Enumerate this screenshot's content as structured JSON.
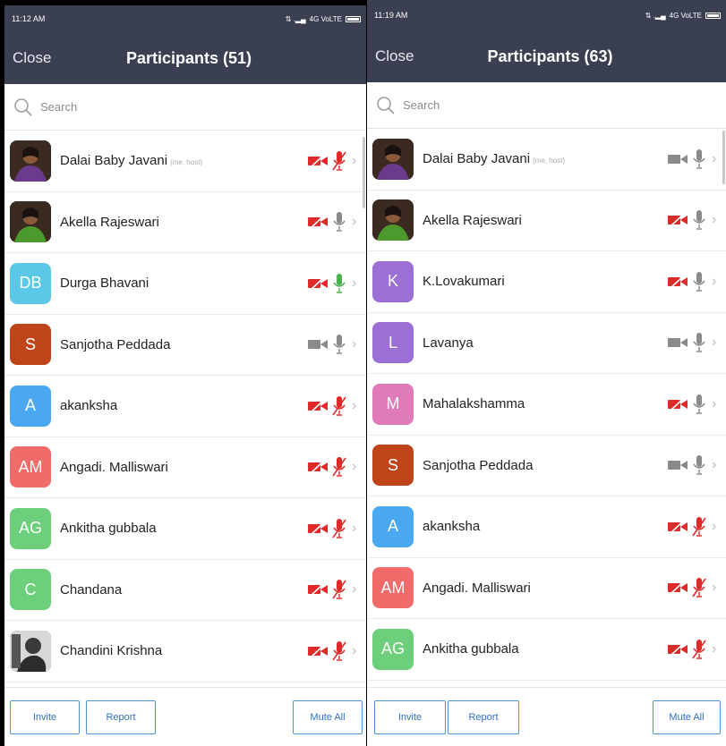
{
  "colors": {
    "header_bg": "#3b3f52",
    "muted_red": "#e02a2a",
    "unmuted_gray": "#8a8a8a",
    "active_green": "#4caf50",
    "button_blue": "#2d6fc0"
  },
  "screens": [
    {
      "status": {
        "time": "11:12 AM",
        "network": "4G VoLTE"
      },
      "close_label": "Close",
      "title": "Participants (51)",
      "search_placeholder": "Search",
      "participants": [
        {
          "name": "Dalai Baby Javani",
          "tag": "(me, host)",
          "avatar": "photo-woman-purple",
          "initials": "",
          "color": "",
          "video": "off",
          "audio": "muted"
        },
        {
          "name": "Akella Rajeswari",
          "tag": "",
          "avatar": "photo-woman-green",
          "initials": "",
          "color": "",
          "video": "off",
          "audio": "on"
        },
        {
          "name": "Durga Bhavani",
          "tag": "",
          "avatar": "",
          "initials": "DB",
          "color": "#5bc8e8",
          "video": "off",
          "audio": "speaking"
        },
        {
          "name": "Sanjotha Peddada",
          "tag": "",
          "avatar": "",
          "initials": "S",
          "color": "#c0441a",
          "video": "on",
          "audio": "on"
        },
        {
          "name": "akanksha",
          "tag": "",
          "avatar": "",
          "initials": "A",
          "color": "#4aa8f0",
          "video": "off",
          "audio": "muted"
        },
        {
          "name": "Angadi. Malliswari",
          "tag": "",
          "avatar": "",
          "initials": "AM",
          "color": "#f26b6b",
          "video": "off",
          "audio": "muted"
        },
        {
          "name": "Ankitha gubbala",
          "tag": "",
          "avatar": "",
          "initials": "AG",
          "color": "#6dcf7b",
          "video": "off",
          "audio": "muted"
        },
        {
          "name": "Chandana",
          "tag": "",
          "avatar": "",
          "initials": "C",
          "color": "#6dcf7b",
          "video": "off",
          "audio": "muted"
        },
        {
          "name": "Chandini Krishna",
          "tag": "",
          "avatar": "photo-bw",
          "initials": "",
          "color": "",
          "video": "off",
          "audio": "muted"
        }
      ],
      "buttons": {
        "invite": "Invite",
        "report": "Report",
        "mute_all": "Mute All"
      }
    },
    {
      "status": {
        "time": "11:19 AM",
        "network": "4G VoLTE"
      },
      "close_label": "Close",
      "title": "Participants (63)",
      "search_placeholder": "Search",
      "participants": [
        {
          "name": "Dalai Baby Javani",
          "tag": "(me, host)",
          "avatar": "photo-woman-purple",
          "initials": "",
          "color": "",
          "video": "on",
          "audio": "on"
        },
        {
          "name": "Akella Rajeswari",
          "tag": "",
          "avatar": "photo-woman-green",
          "initials": "",
          "color": "",
          "video": "off",
          "audio": "on"
        },
        {
          "name": "K.Lovakumari",
          "tag": "",
          "avatar": "",
          "initials": "K",
          "color": "#9b6fd4",
          "video": "off",
          "audio": "on"
        },
        {
          "name": "Lavanya",
          "tag": "",
          "avatar": "",
          "initials": "L",
          "color": "#9b6fd4",
          "video": "on",
          "audio": "on"
        },
        {
          "name": "Mahalakshamma",
          "tag": "",
          "avatar": "",
          "initials": "M",
          "color": "#e07ab8",
          "video": "off",
          "audio": "on"
        },
        {
          "name": "Sanjotha Peddada",
          "tag": "",
          "avatar": "",
          "initials": "S",
          "color": "#c0441a",
          "video": "on",
          "audio": "on"
        },
        {
          "name": "akanksha",
          "tag": "",
          "avatar": "",
          "initials": "A",
          "color": "#4aa8f0",
          "video": "off",
          "audio": "muted"
        },
        {
          "name": "Angadi. Malliswari",
          "tag": "",
          "avatar": "",
          "initials": "AM",
          "color": "#f26b6b",
          "video": "off",
          "audio": "muted"
        },
        {
          "name": "Ankitha gubbala",
          "tag": "",
          "avatar": "",
          "initials": "AG",
          "color": "#6dcf7b",
          "video": "off",
          "audio": "muted"
        }
      ],
      "buttons": {
        "invite": "Invite",
        "report": "Report",
        "mute_all": "Mute All"
      }
    }
  ]
}
